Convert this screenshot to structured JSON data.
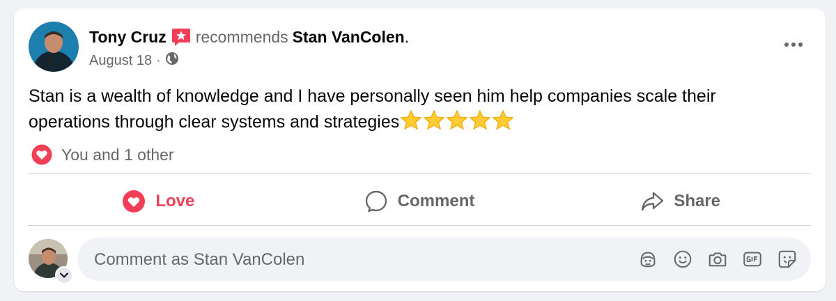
{
  "post": {
    "author": "Tony Cruz",
    "verb": "recommends",
    "target": "Stan VanColen",
    "period": ".",
    "date": "August 18",
    "separator": "·",
    "audience_icon": "globe-icon",
    "badge_icon": "recommendation-star-icon",
    "text": "Stan is a wealth of knowledge and I have personally seen him help companies scale their operations through clear systems and strategies",
    "star_rating": 5,
    "reactions": {
      "icon": "love-reaction-icon",
      "summary": "You and 1 other"
    }
  },
  "actions": [
    {
      "label": "Love",
      "icon": "love-icon",
      "active": true
    },
    {
      "label": "Comment",
      "icon": "comment-icon",
      "active": false
    },
    {
      "label": "Share",
      "icon": "share-icon",
      "active": false
    }
  ],
  "comment_composer": {
    "placeholder": "Comment as Stan VanColen",
    "tools": [
      "avatar-sticker-icon",
      "emoji-icon",
      "camera-icon",
      "gif-icon",
      "sticker-icon"
    ]
  },
  "colors": {
    "love": "#f33e58",
    "muted": "#65676b",
    "text": "#050505",
    "background": "#f0f2f5"
  }
}
